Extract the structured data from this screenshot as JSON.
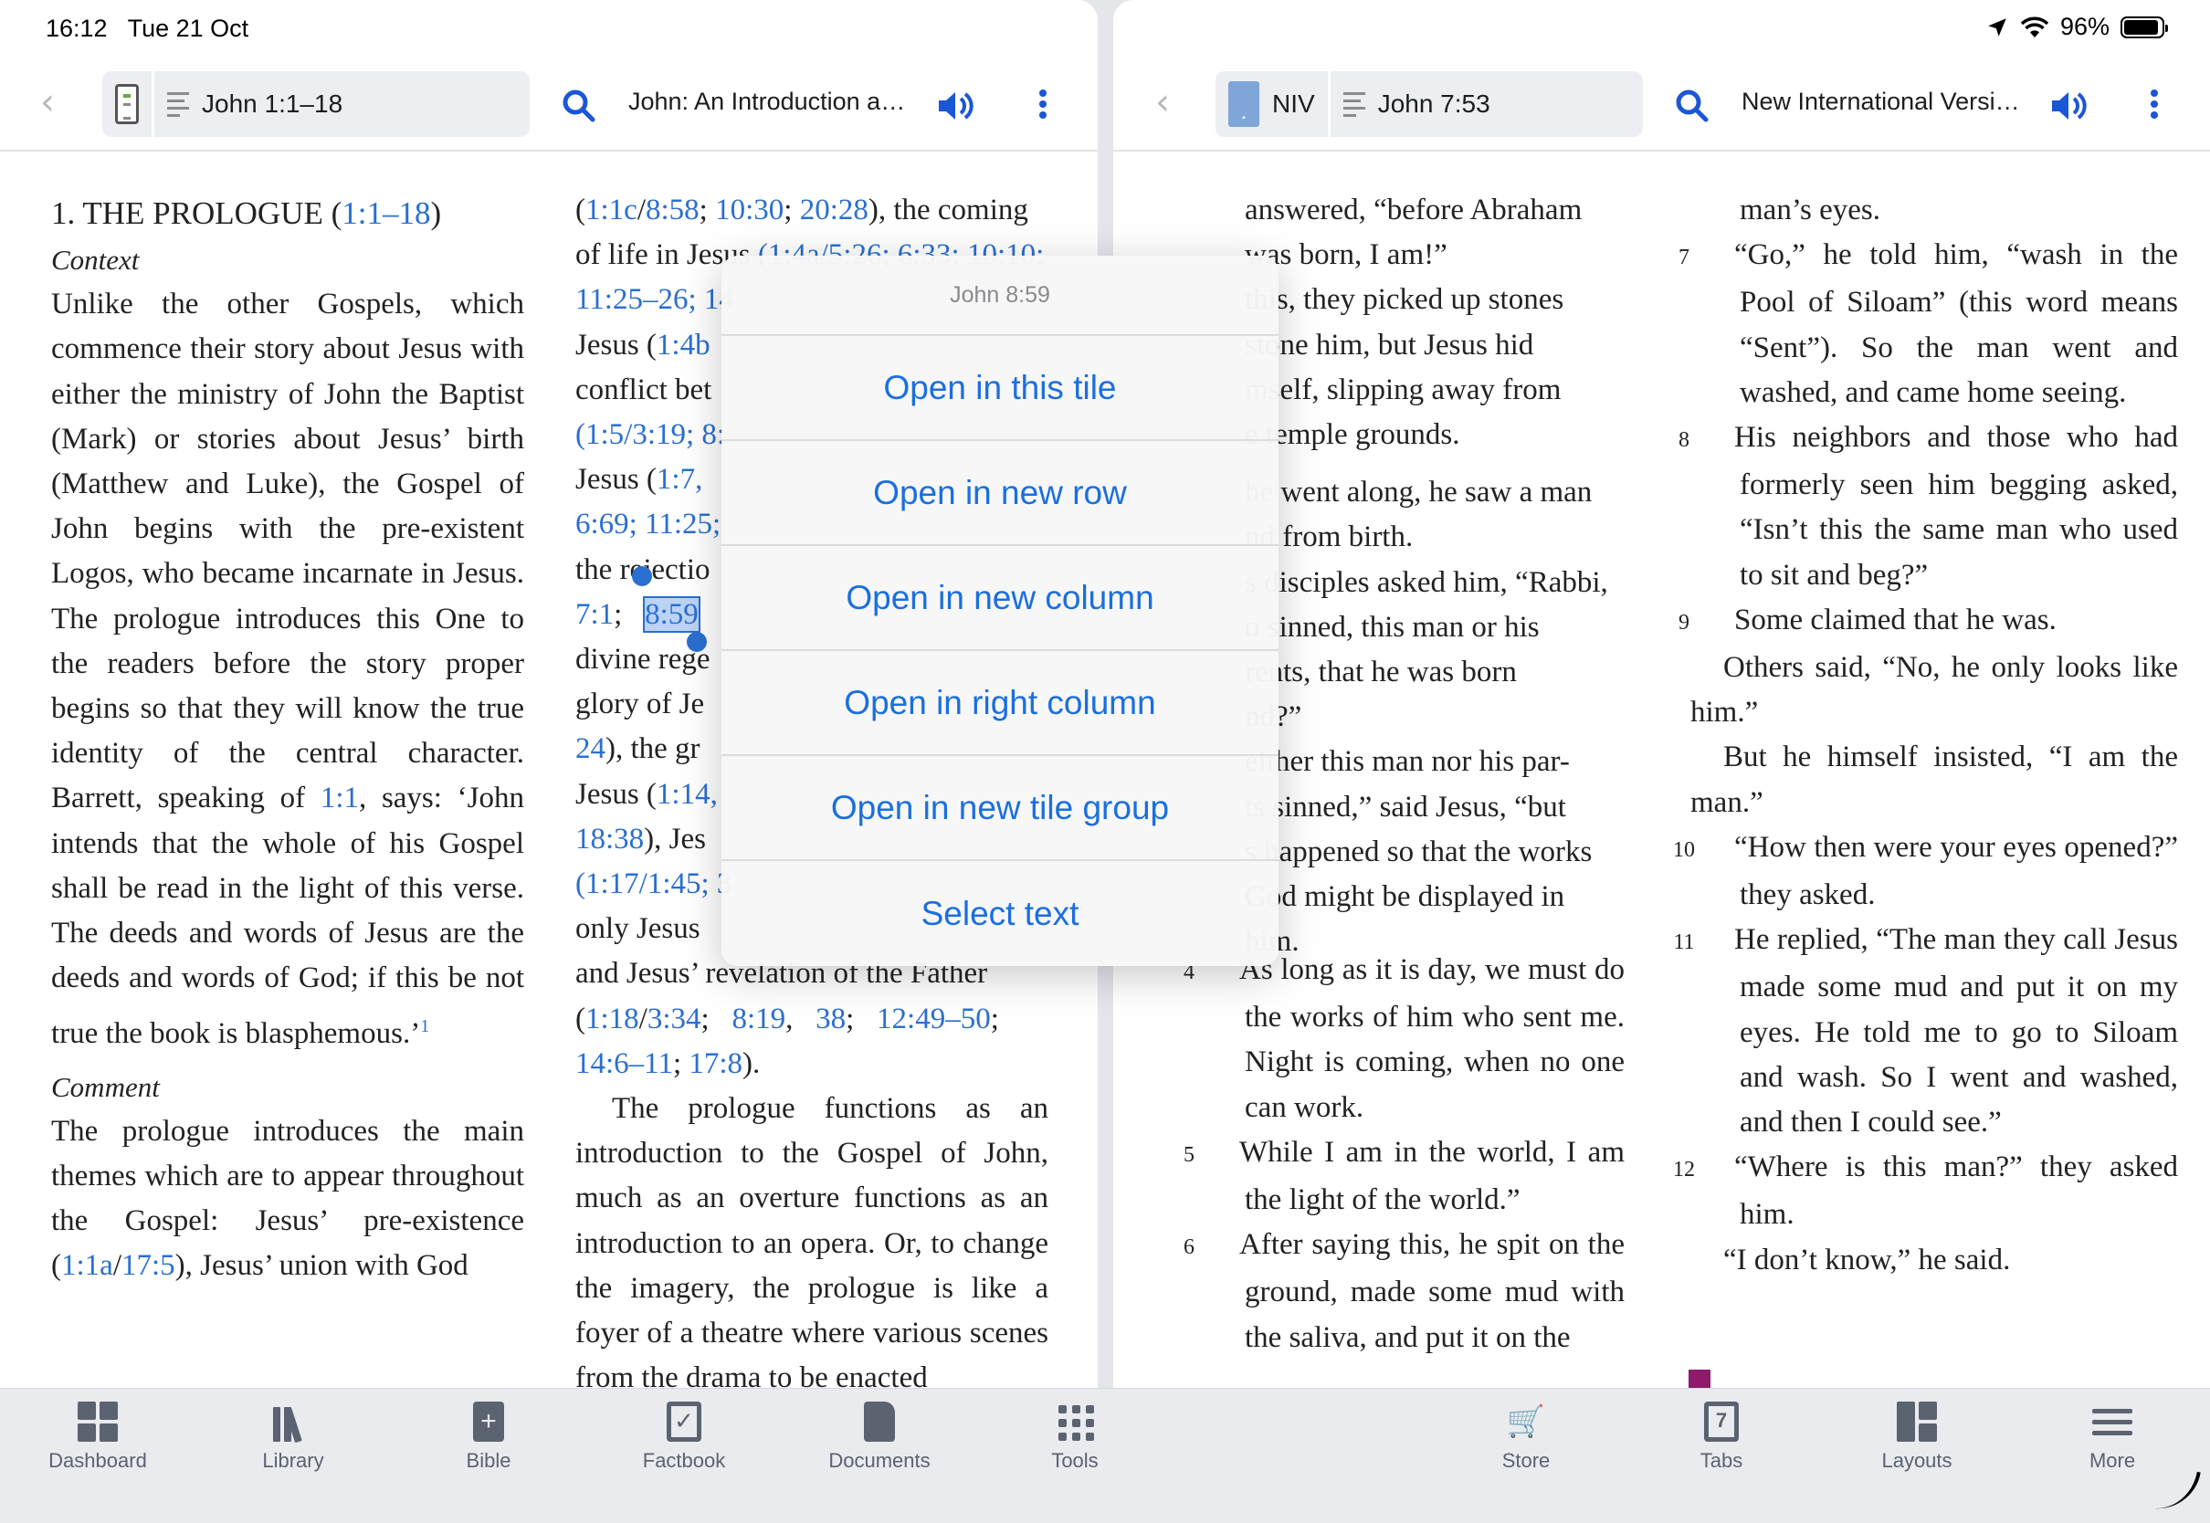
{
  "status": {
    "time": "16:12",
    "date": "Tue 21 Oct",
    "battery": "96%"
  },
  "left_pane": {
    "reference": "John 1:1–18",
    "title": "John: An Introduction a…",
    "col1": {
      "heading_num": "1. THE PROLOGUE (",
      "heading_ref": "1:1–18",
      "heading_end": ")",
      "context_label": "Context",
      "p1a": "Unlike the other Gospels, which commence their story about Jesus with either the ministry of John the Baptist (Mark) or stories about Jesus’ birth (Matthew and Luke), the Gospel of John begins with the pre-existent Logos, who became incarnate in Jesus. The prologue introduces this One to the readers before the story proper begins so that they will know the true identity of the central charac­ter. Barrett, speaking of ",
      "p1ref": "1:1",
      "p1b": ", says: ‘John intends that the whole of his Gospel shall be read in the light of this verse. The deeds and words of Jesus are the deeds and words of God; if this be not true the book is blas­phemous.’",
      "p1note": "1",
      "comment_label": "Comment",
      "p2a": "The prologue introduces the main themes which are to appear through­out the Gospel: Jesus’ pre-existence (",
      "p2ref1": "1:1a",
      "p2slash": "/",
      "p2ref2": "17:5",
      "p2b": "), Jesus’ union with God"
    },
    "col2": {
      "l1_ref1": "1:1c",
      "l1_ref2": "8:58",
      "l1_ref3": "10:30",
      "l1_ref4": "20:28",
      "l1_text": "), the coming",
      "l2": "of life in Jesus",
      "l2_refs": "(1:4a/5:26; 6:33; 10:10;",
      "l3_refs": "11:25–26; 14",
      "l4": "Jesus (",
      "l4_ref": "1:4b",
      "l5": "conflict bet",
      "l6_refs": "(1:5/3:19; 8:",
      "l7": "Jesus (",
      "l7_ref": "1:7, ",
      "l8_refs": "6:69; 11:25;",
      "l9": "the rejectio",
      "l10_ref": "7:1",
      "l10_sel": "8:59",
      "l11": "divine rege",
      "l12": "glory of Je",
      "l13_ref": "24",
      "l13": "), the gr",
      "l14": "Jesus (",
      "l14_ref": "1:14,",
      "l15_ref": "18:38",
      "l15": "), Jes",
      "l16_refs": "(1:17/1:45; 3",
      "l17": "only Jesus",
      "l18": "and Jesus’ revelation of the Father",
      "l19_ref1": "1:18",
      "l19_ref2": "3:34",
      "l19_ref3": "8:19",
      "l19_ref4": "38",
      "l19_ref5": "12:49–50",
      "l20_ref1": "14:6–11",
      "l20_ref2": "17:8",
      "p2": "The prologue functions as an introduction to the Gospel of John, much as an overture functions as an introduction to an opera. Or, to change the imagery, the prologue is like a foyer of a theatre where various scenes from the drama to be enacted"
    }
  },
  "right_pane": {
    "version": "NIV",
    "reference": "John 7:53",
    "title": "New International Versi…",
    "col1": {
      "t1": "answered, “before Abraham",
      "t2": "was born, I am!”",
      "t3": "this, they picked up stones",
      "t4": "stone him, but Jesus hid",
      "t5": "mself, slipping away from",
      "t6": "e temple grounds.",
      "t7": "he went along, he saw a man",
      "t8": "nd from birth.",
      "t9": "s disciples asked him, “Rabbi,",
      "t10": "o sinned, this man or his",
      "t11": "rents, that he was born",
      "t12": "nd?”",
      "t13": "either this man nor his par-",
      "t14": "ts sinned,” said Jesus, “but",
      "t15": "s happened so that the works",
      "t16": "God might be displayed in",
      "t17": "him.",
      "v4": "4",
      "v4t": "As long as it is day, we must do the works of him who sent me. Night is coming, when no one can work.",
      "v5": "5",
      "v5t": "While I am in the world, I am the light of the world.”",
      "v6": "6",
      "v6t": "After saying this, he spit on the ground, made some mud with the saliva, and put it on the"
    },
    "col2": {
      "c0": "man’s eyes.",
      "v7": "7",
      "v7t": "“Go,” he told him, “wash in the Pool of Siloam” (this word means “Sent”). So the man went and washed, and came home seeing.",
      "v8": "8",
      "v8t": "His neighbors and those who had formerly seen him begging asked, “Isn’t this the same man who used to sit and beg?”",
      "v9": "9",
      "v9t": "Some claimed that he was.",
      "q1": "Others said, “No, he only looks like him.”",
      "q2": "But he himself insisted, “I am the man.”",
      "v10": "10",
      "v10t": "“How then were your eyes opened?” they asked.",
      "v11": "11",
      "v11t": "He replied, “The man they call Jesus made some mud and put it on my eyes. He told me to go to Siloam and wash. So I went and washed, and then I could see.”",
      "v12": "12",
      "v12t": "“Where is this man?” they asked him.",
      "q3": "“I don’t know,” he said."
    }
  },
  "popup": {
    "title": "John 8:59",
    "options": [
      "Open in this tile",
      "Open in new row",
      "Open in new column",
      "Open in right column",
      "Open in new tile group",
      "Select text"
    ]
  },
  "tabbar": {
    "items": [
      "Dashboard",
      "Library",
      "Bible",
      "Factbook",
      "Documents",
      "Tools",
      "Store",
      "Tabs",
      "Layouts",
      "More"
    ],
    "tabs_count": "7"
  },
  "colors": {
    "accent": "#1a56d6",
    "link": "#2a6fd1",
    "highlight": "#8d1a6a"
  }
}
